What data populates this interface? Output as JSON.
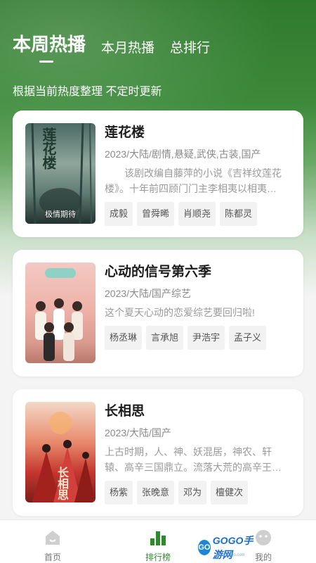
{
  "tabs": [
    {
      "label": "本周热播",
      "active": true
    },
    {
      "label": "本月热播",
      "active": false
    },
    {
      "label": "总排行",
      "active": false
    }
  ],
  "subtitle": "根据当前热度整理 不定时更新",
  "items": [
    {
      "title": "莲花楼",
      "meta": "2023/大陆/剧情,悬疑,武侠,古装,国产",
      "desc": "该剧改编自藤萍的小说《吉祥纹莲花楼》。十年前四顾门门主李相夷以相夷…",
      "cast": [
        "成毅",
        "曾舜晞",
        "肖顺尧",
        "陈都灵"
      ],
      "poster_text": "莲花楼",
      "poster_label": "极情期待",
      "poster_colors": [
        "#3b5a55",
        "#7c948b",
        "#1e2d2a"
      ]
    },
    {
      "title": "心动的信号第六季",
      "meta": "2023/大陆/国产综艺",
      "desc": "这个夏天心动的恋爱综艺要回归啦!",
      "cast": [
        "杨丞琳",
        "言承旭",
        "尹浩宇",
        "孟子义"
      ],
      "poster_text": "",
      "poster_label": "",
      "poster_colors": [
        "#f4c6c0",
        "#e8a79f",
        "#c98b7f"
      ]
    },
    {
      "title": "长相思",
      "meta": "2023/大陆/国产",
      "desc": "上古时期，人、神、妖混居，神农、轩辕、高辛三国鼎立。流落大荒的高辛王…",
      "cast": [
        "杨紫",
        "张晚意",
        "邓为",
        "檀健次"
      ],
      "poster_text": "长相思",
      "poster_label": "",
      "poster_colors": [
        "#c4372f",
        "#e56a4b",
        "#7a1e1a"
      ]
    }
  ],
  "nav": [
    {
      "label": "首页",
      "icon": "home-icon",
      "active": false
    },
    {
      "label": "排行榜",
      "icon": "ranking-icon",
      "active": true
    },
    {
      "label": "我的",
      "icon": "profile-icon",
      "active": false
    }
  ],
  "watermark": {
    "brand": "GOGO手游网",
    "badge": "GO",
    "site": "www.gogo.com"
  },
  "colors": {
    "accent": "#2f8a2d",
    "header": "#2f7a2d"
  }
}
